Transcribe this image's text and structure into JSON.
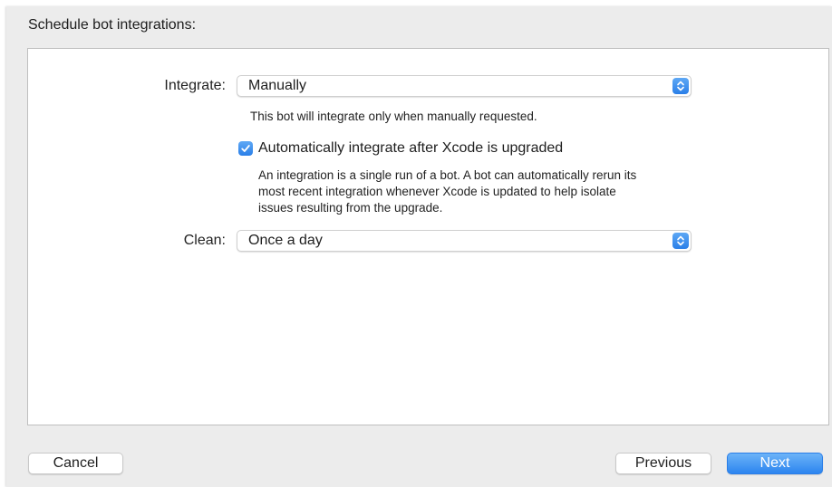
{
  "heading": "Schedule bot integrations:",
  "integrate": {
    "label": "Integrate:",
    "value": "Manually",
    "hint": "This bot will integrate only when manually requested."
  },
  "auto_upgrade": {
    "checked": true,
    "label": "Automatically integrate after Xcode is upgraded",
    "description_lines": [
      "An integration is a single run of a bot. A bot can automatically rerun its",
      "most recent integration whenever Xcode is updated to help isolate",
      "issues resulting from the upgrade."
    ]
  },
  "clean": {
    "label": "Clean:",
    "value": "Once a day"
  },
  "buttons": {
    "cancel": "Cancel",
    "previous": "Previous",
    "next": "Next"
  },
  "colors": {
    "accent": "#2a7fe8",
    "sheet_background": "#ececec"
  },
  "icons": {
    "popup_indicator": "chevron-up-down-icon",
    "checkmark": "checkmark-icon"
  }
}
